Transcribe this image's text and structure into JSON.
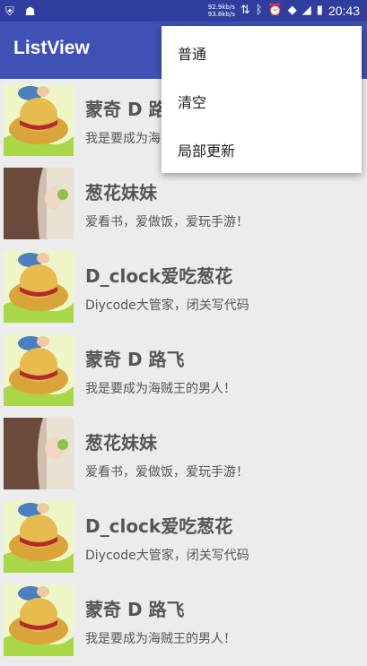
{
  "status_bar": {
    "speed_down": "92.9kb/s",
    "speed_up": "93.8kb/s",
    "time": "20:43",
    "icons": [
      "shield-icon",
      "android-icon",
      "data-arrows-icon",
      "bluetooth-icon",
      "alarm-icon",
      "wifi-icon",
      "signal-icon",
      "battery-icon"
    ]
  },
  "toolbar": {
    "title": "ListView"
  },
  "menu": {
    "items": [
      "普通",
      "清空",
      "局部更新"
    ]
  },
  "list": {
    "items": [
      {
        "name": "蒙奇 D 路飞",
        "desc": "我是要成为海贼王的男人！",
        "avatar": "straw-hat"
      },
      {
        "name": "葱花妹妹",
        "desc": "爱看书，爱做饭，爱玩手游！",
        "avatar": "girl-photo"
      },
      {
        "name": "D_clock爱吃葱花",
        "desc": "Diycode大管家，闭关写代码",
        "avatar": "straw-hat"
      },
      {
        "name": "蒙奇 D 路飞",
        "desc": "我是要成为海贼王的男人！",
        "avatar": "straw-hat"
      },
      {
        "name": "葱花妹妹",
        "desc": "爱看书，爱做饭，爱玩手游！",
        "avatar": "girl-photo"
      },
      {
        "name": "D_clock爱吃葱花",
        "desc": "Diycode大管家，闭关写代码",
        "avatar": "straw-hat"
      },
      {
        "name": "蒙奇 D 路飞",
        "desc": "我是要成为海贼王的男人！",
        "avatar": "straw-hat"
      }
    ]
  },
  "colors": {
    "status_bar": "#303f9f",
    "toolbar": "#3f51b5",
    "list_bg": "#ececec",
    "menu_bg": "#ffffff"
  }
}
